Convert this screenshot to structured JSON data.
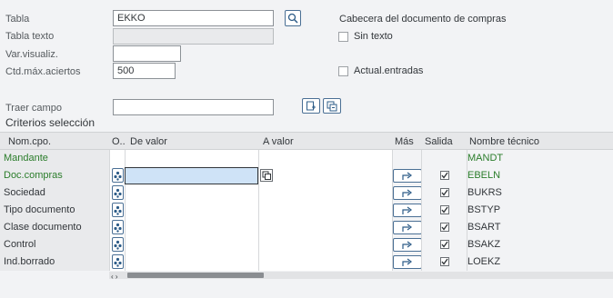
{
  "form": {
    "tabla_label": "Tabla",
    "tabla_value": "EKKO",
    "tabla_texto_label": "Tabla texto",
    "tabla_texto_value": "",
    "var_visualiz_label": "Var.visualiz.",
    "var_visualiz_value": "",
    "ctd_label": "Ctd.máx.aciertos",
    "ctd_value": "500",
    "traer_label": "Traer campo",
    "traer_value": ""
  },
  "header_section": {
    "title": "Cabecera del documento de compras",
    "sin_texto": "Sin texto",
    "actual_entradas": "Actual.entradas"
  },
  "criterios": {
    "title": "Criterios selección",
    "columns": [
      "Nom.cpo.",
      "O..",
      "De valor",
      "A valor",
      "Más",
      "Salida",
      "Nombre técnico"
    ],
    "rows": [
      {
        "name": "Mandante",
        "tech": "MANDT",
        "green": true,
        "op": false,
        "mas": false,
        "salida": false,
        "active": false
      },
      {
        "name": "Doc.compras",
        "tech": "EBELN",
        "green": true,
        "op": true,
        "mas": true,
        "salida": true,
        "active": true
      },
      {
        "name": "Sociedad",
        "tech": "BUKRS",
        "green": false,
        "op": true,
        "mas": true,
        "salida": true,
        "active": false
      },
      {
        "name": "Tipo documento",
        "tech": "BSTYP",
        "green": false,
        "op": true,
        "mas": true,
        "salida": true,
        "active": false
      },
      {
        "name": "Clase documento",
        "tech": "BSART",
        "green": false,
        "op": true,
        "mas": true,
        "salida": true,
        "active": false
      },
      {
        "name": "Control",
        "tech": "BSAKZ",
        "green": false,
        "op": true,
        "mas": true,
        "salida": true,
        "active": false
      },
      {
        "name": "Ind.borrado",
        "tech": "LOEKZ",
        "green": false,
        "op": true,
        "mas": true,
        "salida": true,
        "active": false
      }
    ]
  },
  "scroll_arrows": "‹ ›",
  "colors": {
    "accent": "#4a6f94",
    "green_text": "#2b7d2b",
    "focus_fill": "#cfe3f7"
  }
}
